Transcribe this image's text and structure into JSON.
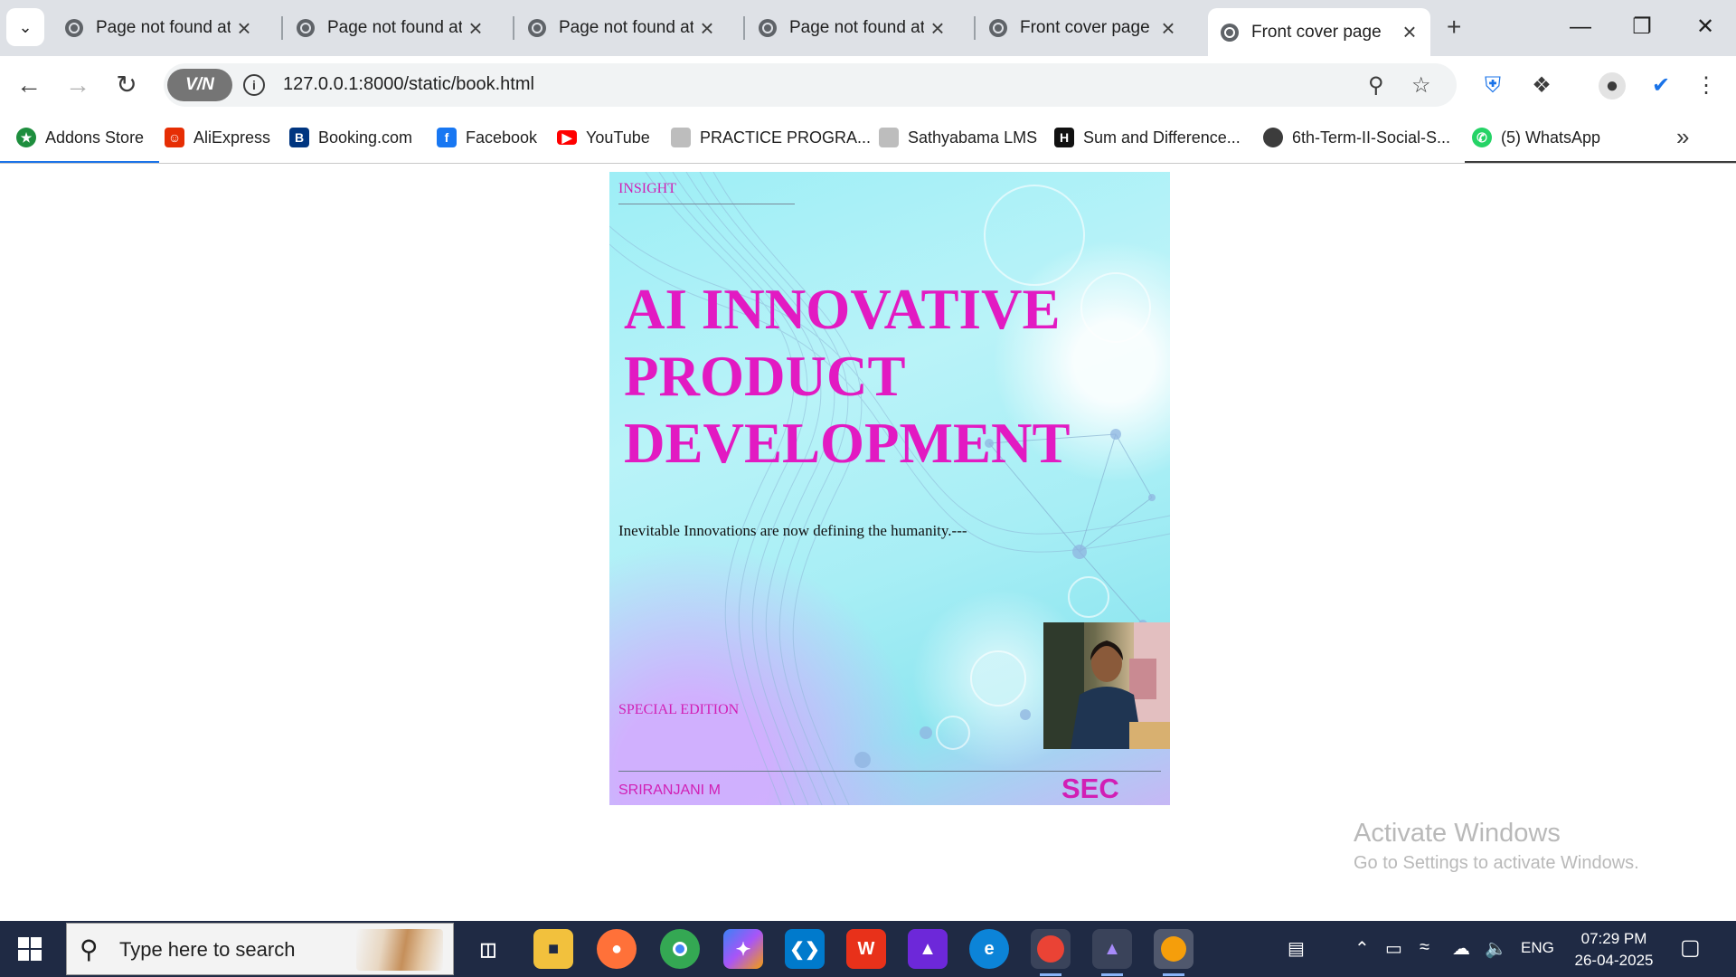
{
  "browser": {
    "tabs": [
      {
        "title": "Page not found at",
        "active": false
      },
      {
        "title": "Page not found at",
        "active": false
      },
      {
        "title": "Page not found at",
        "active": false
      },
      {
        "title": "Page not found at",
        "active": false
      },
      {
        "title": "Front cover page",
        "active": false
      },
      {
        "title": "Front cover page",
        "active": true
      }
    ],
    "url": "127.0.0.1:8000/static/book.html",
    "vpn_label": "V/N"
  },
  "bookmarks": [
    {
      "label": "Addons Store",
      "icon": "addons-icon",
      "color": "#1e8e3e"
    },
    {
      "label": "AliExpress",
      "icon": "aliexpress-icon",
      "color": "#e62e04"
    },
    {
      "label": "Booking.com",
      "icon": "booking-icon",
      "color": "#003580"
    },
    {
      "label": "Facebook",
      "icon": "facebook-icon",
      "color": "#1877f2"
    },
    {
      "label": "YouTube",
      "icon": "youtube-icon",
      "color": "#ff0000"
    },
    {
      "label": "PRACTICE PROGRA...",
      "icon": "page-icon",
      "color": "#9e9e9e"
    },
    {
      "label": "Sathyabama LMS",
      "icon": "page-icon",
      "color": "#9e9e9e"
    },
    {
      "label": "Sum and Difference...",
      "icon": "hackerrank-icon",
      "color": "#111111"
    },
    {
      "label": "6th-Term-II-Social-S...",
      "icon": "globe-icon",
      "color": "#3c3c3c"
    },
    {
      "label": "(5) WhatsApp",
      "icon": "whatsapp-icon",
      "color": "#25d366"
    }
  ],
  "cover": {
    "insight": "INSIGHT",
    "title_line1": "AI INNOVATIVE",
    "title_line2": "PRODUCT",
    "title_line3": "DEVELOPMENT",
    "tagline": "Inevitable Innovations are now defining the humanity.---",
    "special": "SPECIAL EDITION",
    "author": "SRIRANJANI M",
    "publisher": "SEC",
    "accent_color": "#e21ac2"
  },
  "watermark": {
    "line1": "Activate Windows",
    "line2": "Go to Settings to activate Windows."
  },
  "taskbar": {
    "search_placeholder": "Type here to search",
    "language": "ENG",
    "time": "07:29 PM",
    "date": "26-04-2025"
  }
}
